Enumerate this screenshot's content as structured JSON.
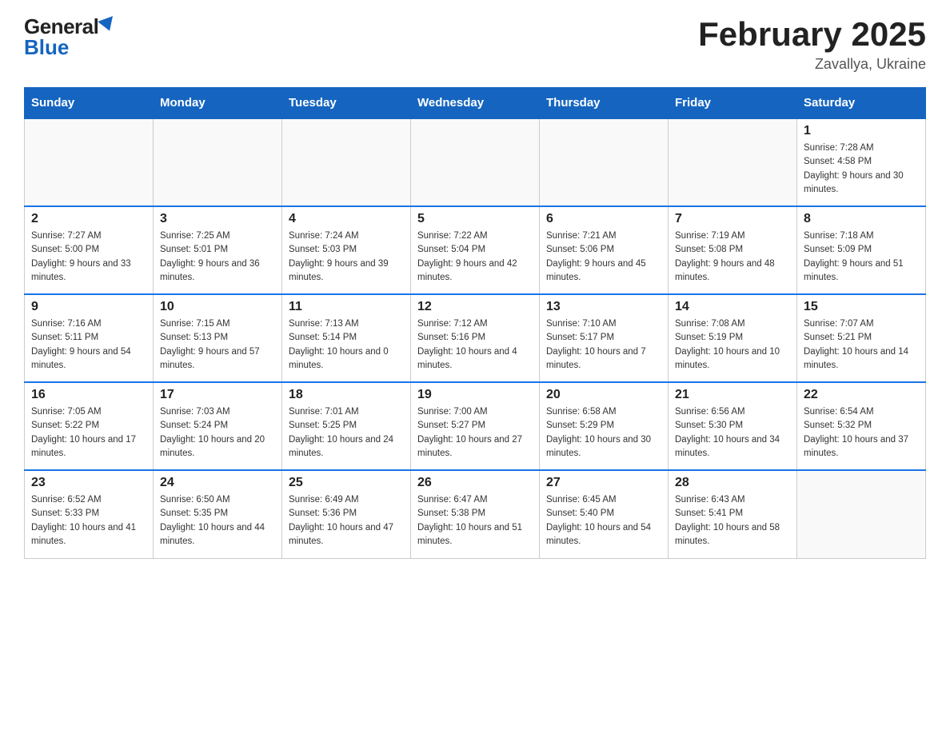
{
  "header": {
    "logo_general": "General",
    "logo_blue": "Blue",
    "month_title": "February 2025",
    "location": "Zavallya, Ukraine"
  },
  "days_of_week": [
    "Sunday",
    "Monday",
    "Tuesday",
    "Wednesday",
    "Thursday",
    "Friday",
    "Saturday"
  ],
  "weeks": [
    [
      {
        "day": "",
        "info": ""
      },
      {
        "day": "",
        "info": ""
      },
      {
        "day": "",
        "info": ""
      },
      {
        "day": "",
        "info": ""
      },
      {
        "day": "",
        "info": ""
      },
      {
        "day": "",
        "info": ""
      },
      {
        "day": "1",
        "info": "Sunrise: 7:28 AM\nSunset: 4:58 PM\nDaylight: 9 hours and 30 minutes."
      }
    ],
    [
      {
        "day": "2",
        "info": "Sunrise: 7:27 AM\nSunset: 5:00 PM\nDaylight: 9 hours and 33 minutes."
      },
      {
        "day": "3",
        "info": "Sunrise: 7:25 AM\nSunset: 5:01 PM\nDaylight: 9 hours and 36 minutes."
      },
      {
        "day": "4",
        "info": "Sunrise: 7:24 AM\nSunset: 5:03 PM\nDaylight: 9 hours and 39 minutes."
      },
      {
        "day": "5",
        "info": "Sunrise: 7:22 AM\nSunset: 5:04 PM\nDaylight: 9 hours and 42 minutes."
      },
      {
        "day": "6",
        "info": "Sunrise: 7:21 AM\nSunset: 5:06 PM\nDaylight: 9 hours and 45 minutes."
      },
      {
        "day": "7",
        "info": "Sunrise: 7:19 AM\nSunset: 5:08 PM\nDaylight: 9 hours and 48 minutes."
      },
      {
        "day": "8",
        "info": "Sunrise: 7:18 AM\nSunset: 5:09 PM\nDaylight: 9 hours and 51 minutes."
      }
    ],
    [
      {
        "day": "9",
        "info": "Sunrise: 7:16 AM\nSunset: 5:11 PM\nDaylight: 9 hours and 54 minutes."
      },
      {
        "day": "10",
        "info": "Sunrise: 7:15 AM\nSunset: 5:13 PM\nDaylight: 9 hours and 57 minutes."
      },
      {
        "day": "11",
        "info": "Sunrise: 7:13 AM\nSunset: 5:14 PM\nDaylight: 10 hours and 0 minutes."
      },
      {
        "day": "12",
        "info": "Sunrise: 7:12 AM\nSunset: 5:16 PM\nDaylight: 10 hours and 4 minutes."
      },
      {
        "day": "13",
        "info": "Sunrise: 7:10 AM\nSunset: 5:17 PM\nDaylight: 10 hours and 7 minutes."
      },
      {
        "day": "14",
        "info": "Sunrise: 7:08 AM\nSunset: 5:19 PM\nDaylight: 10 hours and 10 minutes."
      },
      {
        "day": "15",
        "info": "Sunrise: 7:07 AM\nSunset: 5:21 PM\nDaylight: 10 hours and 14 minutes."
      }
    ],
    [
      {
        "day": "16",
        "info": "Sunrise: 7:05 AM\nSunset: 5:22 PM\nDaylight: 10 hours and 17 minutes."
      },
      {
        "day": "17",
        "info": "Sunrise: 7:03 AM\nSunset: 5:24 PM\nDaylight: 10 hours and 20 minutes."
      },
      {
        "day": "18",
        "info": "Sunrise: 7:01 AM\nSunset: 5:25 PM\nDaylight: 10 hours and 24 minutes."
      },
      {
        "day": "19",
        "info": "Sunrise: 7:00 AM\nSunset: 5:27 PM\nDaylight: 10 hours and 27 minutes."
      },
      {
        "day": "20",
        "info": "Sunrise: 6:58 AM\nSunset: 5:29 PM\nDaylight: 10 hours and 30 minutes."
      },
      {
        "day": "21",
        "info": "Sunrise: 6:56 AM\nSunset: 5:30 PM\nDaylight: 10 hours and 34 minutes."
      },
      {
        "day": "22",
        "info": "Sunrise: 6:54 AM\nSunset: 5:32 PM\nDaylight: 10 hours and 37 minutes."
      }
    ],
    [
      {
        "day": "23",
        "info": "Sunrise: 6:52 AM\nSunset: 5:33 PM\nDaylight: 10 hours and 41 minutes."
      },
      {
        "day": "24",
        "info": "Sunrise: 6:50 AM\nSunset: 5:35 PM\nDaylight: 10 hours and 44 minutes."
      },
      {
        "day": "25",
        "info": "Sunrise: 6:49 AM\nSunset: 5:36 PM\nDaylight: 10 hours and 47 minutes."
      },
      {
        "day": "26",
        "info": "Sunrise: 6:47 AM\nSunset: 5:38 PM\nDaylight: 10 hours and 51 minutes."
      },
      {
        "day": "27",
        "info": "Sunrise: 6:45 AM\nSunset: 5:40 PM\nDaylight: 10 hours and 54 minutes."
      },
      {
        "day": "28",
        "info": "Sunrise: 6:43 AM\nSunset: 5:41 PM\nDaylight: 10 hours and 58 minutes."
      },
      {
        "day": "",
        "info": ""
      }
    ]
  ]
}
